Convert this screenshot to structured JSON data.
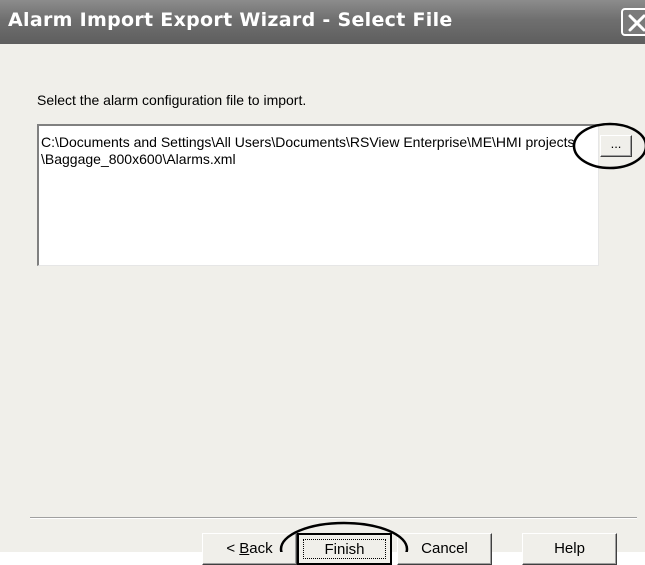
{
  "window": {
    "title": "Alarm Import Export Wizard - Select File"
  },
  "content": {
    "instruction": "Select the alarm configuration file to import.",
    "file_path": "C:\\Documents and Settings\\All Users\\Documents\\RSView Enterprise\\ME\\HMI projects\\Baggage_800x600\\Alarms.xml",
    "browse_label": "..."
  },
  "buttons": {
    "back_prefix": "< ",
    "back_mnemonic": "B",
    "back_rest": "ack",
    "finish": "Finish",
    "cancel": "Cancel",
    "help": "Help"
  },
  "icons": {
    "close": "close-icon"
  }
}
